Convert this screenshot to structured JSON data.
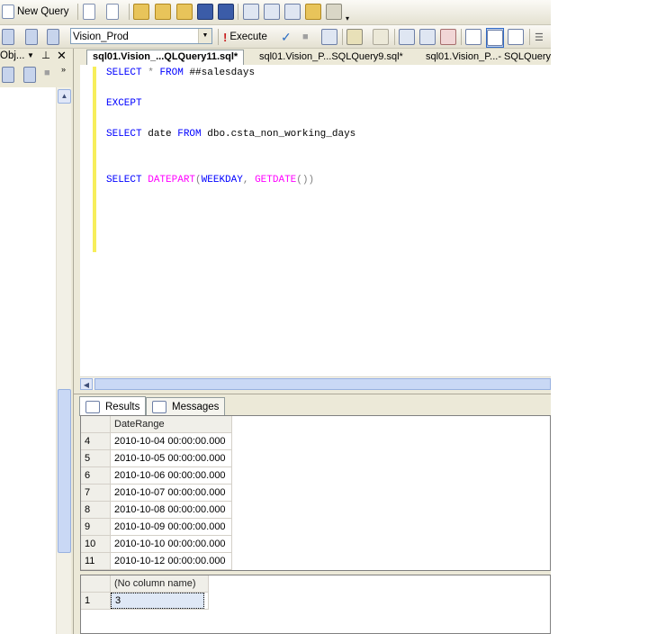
{
  "toolbar1": {
    "new_query_label": "New Query",
    "icons": [
      "new-file-icon",
      "new-query-file-icon",
      "open-folder-icon",
      "open-project-icon",
      "open-file-icon",
      "save-icon",
      "save-all-icon",
      "activity-monitor-icon",
      "registered-servers-icon",
      "object-explorer-icon",
      "template-explorer-icon",
      "properties-icon"
    ]
  },
  "toolbar2": {
    "database": "Vision_Prod",
    "execute_label": "Execute"
  },
  "explorer": {
    "title": "Obj..."
  },
  "tabs": [
    {
      "label": "sql01.Vision_...QLQuery11.sql*",
      "active": true
    },
    {
      "label": "sql01.Vision_P...SQLQuery9.sql*",
      "active": false
    },
    {
      "label": "sql01.Vision_P...- SQLQuery",
      "active": false
    }
  ],
  "code": {
    "l1_kw1": "SELECT",
    "l1_star": "*",
    "l1_kw2": "FROM",
    "l1_tx": "##salesdays",
    "l2_kw": "EXCEPT",
    "l3_kw1": "SELECT",
    "l3_tx1": "date",
    "l3_kw2": "FROM",
    "l3_tx2": "dbo.csta_non_working_days",
    "l4_kw1": "SELECT",
    "l4_fn1": "DATEPART",
    "l4_p1": "(",
    "l4_kw2": "WEEKDAY",
    "l4_c": ",",
    "l4_fn2": "GETDATE",
    "l4_p2": "())"
  },
  "result_tabs": {
    "results": "Results",
    "messages": "Messages"
  },
  "grid1": {
    "column": "DateRange",
    "rows": [
      {
        "n": "4",
        "v": "2010-10-04 00:00:00.000"
      },
      {
        "n": "5",
        "v": "2010-10-05 00:00:00.000"
      },
      {
        "n": "6",
        "v": "2010-10-06 00:00:00.000"
      },
      {
        "n": "7",
        "v": "2010-10-07 00:00:00.000"
      },
      {
        "n": "8",
        "v": "2010-10-08 00:00:00.000"
      },
      {
        "n": "9",
        "v": "2010-10-09 00:00:00.000"
      },
      {
        "n": "10",
        "v": "2010-10-10 00:00:00.000"
      },
      {
        "n": "11",
        "v": "2010-10-12 00:00:00.000"
      }
    ]
  },
  "grid2": {
    "column": "(No column name)",
    "rows": [
      {
        "n": "1",
        "v": "3"
      }
    ]
  },
  "colors": {
    "keyword": "#0000ff",
    "function": "#ff00ff",
    "change_bar": "#f7ee5a",
    "chrome": "#ece9d8"
  }
}
